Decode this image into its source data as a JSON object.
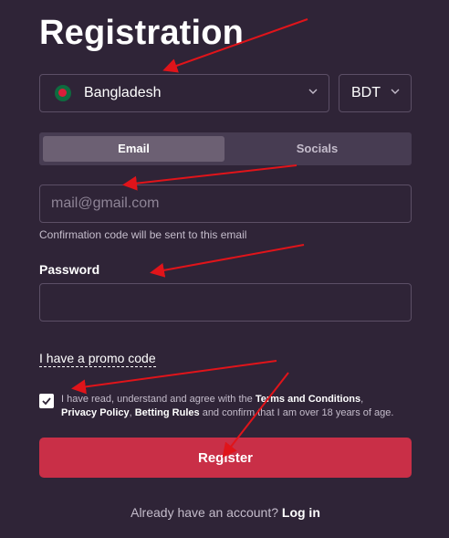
{
  "title": "Registration",
  "country": {
    "label": "Bangladesh",
    "flag_colors": {
      "field": "#0e6b3f",
      "disc": "#d91e3a"
    }
  },
  "currency": {
    "label": "BDT"
  },
  "tabs": [
    {
      "label": "Email",
      "active": true
    },
    {
      "label": "Socials",
      "active": false
    }
  ],
  "email": {
    "placeholder": "mail@gmail.com",
    "hint": "Confirmation code will be sent to this email"
  },
  "password": {
    "label": "Password"
  },
  "promo": {
    "label": "I have a promo code"
  },
  "agreement": {
    "checked": true,
    "text_prefix": "I have read, understand and agree with the ",
    "terms_link": "Terms and Conditions",
    "sep1": ",",
    "privacy_link": "Privacy Policy",
    "sep2": ", ",
    "betting_link": "Betting Rules",
    "text_suffix": " and confirm that I am over 18 years of age."
  },
  "register_button": {
    "label": "Register"
  },
  "footer": {
    "question": "Already have an account?",
    "login_link": "Log in"
  },
  "colors": {
    "background": "#2f2437",
    "accent": "#c92f47",
    "annotation_arrow": "#e0141a"
  }
}
